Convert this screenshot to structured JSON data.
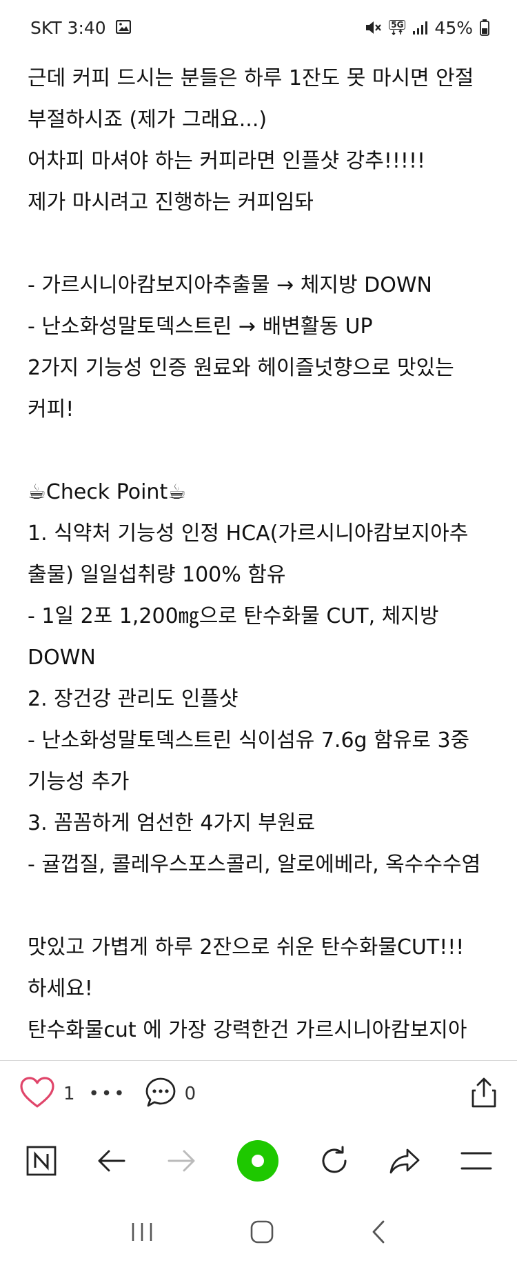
{
  "status_bar": {
    "carrier_time": "SKT 3:40",
    "network": "5G",
    "battery": "45%",
    "icons": [
      "gallery-icon",
      "mute-icon",
      "network-5g-icon",
      "signal-icon",
      "battery-icon"
    ]
  },
  "post": {
    "lines": [
      "근데 커피 드시는 분들은 하루 1잔도 못 마시면 안절",
      "부절하시죠 (제가 그래요...)",
      "어차피 마셔야 하는 커피라면 인플샷 강추!!!!!",
      "제가 마시려고 진행하는 커피임돠",
      "",
      "- 가르시니아캄보지아추출물 → 체지방 DOWN",
      "- 난소화성말토덱스트린 → 배변활동 UP",
      "2가지 기능성 인증 원료와 헤이즐넛향으로 맛있는",
      "커피!",
      "",
      "☕Check Point☕",
      "1. 식약처 기능성 인정 HCA(가르시니아캄보지아추",
      "출물) 일일섭취량 100% 함유",
      "- 1일 2포 1,200㎎으로 탄수화물 CUT, 체지방",
      "DOWN",
      "2. 장건강 관리도 인플샷",
      "- 난소화성말토덱스트린 식이섬유 7.6g 함유로 3중",
      "기능성 추가",
      "3. 꼼꼼하게 엄선한 4가지 부원료",
      "- 귤껍질, 콜레우스포스콜리, 알로에베라, 옥수수수염",
      "",
      "맛있고 가볍게 하루 2잔으로 쉬운 탄수화물CUT!!!",
      "하세요!",
      "탄수화물cut 에 가장 강력한건 가르시니아캄보지아"
    ]
  },
  "actions": {
    "like_count": "1",
    "more": "•••",
    "comment_count": "0"
  },
  "colors": {
    "like": "#e0456a",
    "accent_green": "#1ec800",
    "icon": "#222222",
    "disabled": "#bbbbbb"
  }
}
